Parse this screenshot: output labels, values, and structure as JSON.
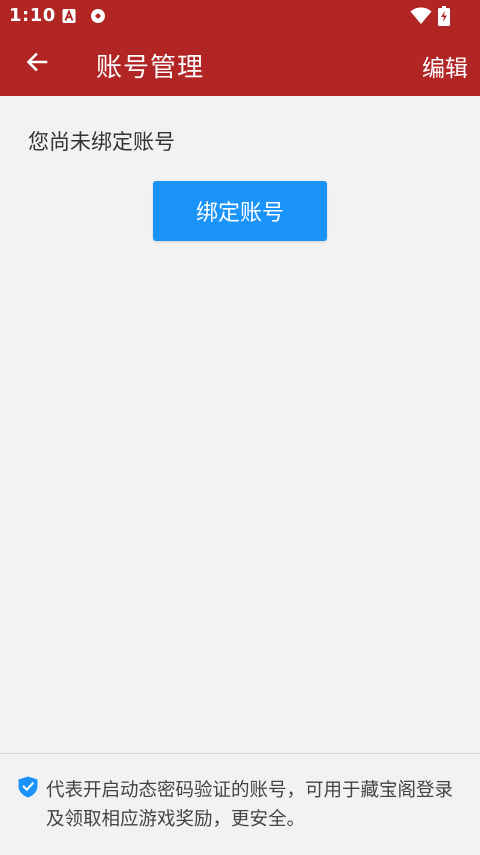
{
  "status_bar": {
    "time": "1:10",
    "icons": [
      "font-a-icon",
      "circle-badge-icon",
      "wifi-icon",
      "battery-charging-icon"
    ]
  },
  "toolbar": {
    "title": "账号管理",
    "edit_label": "编辑",
    "back_icon": "arrow-left-icon"
  },
  "main": {
    "unbound_text": "您尚未绑定账号",
    "bind_button_label": "绑定账号"
  },
  "footer": {
    "icon": "shield-check-icon",
    "note": "代表开启动态密码验证的账号，可用于藏宝阁登录及领取相应游戏奖励，更安全。"
  },
  "colors": {
    "header": "#b12525",
    "background": "#f2f2f2",
    "primary_button": "#1a94fb",
    "shield": "#1a94fb"
  }
}
